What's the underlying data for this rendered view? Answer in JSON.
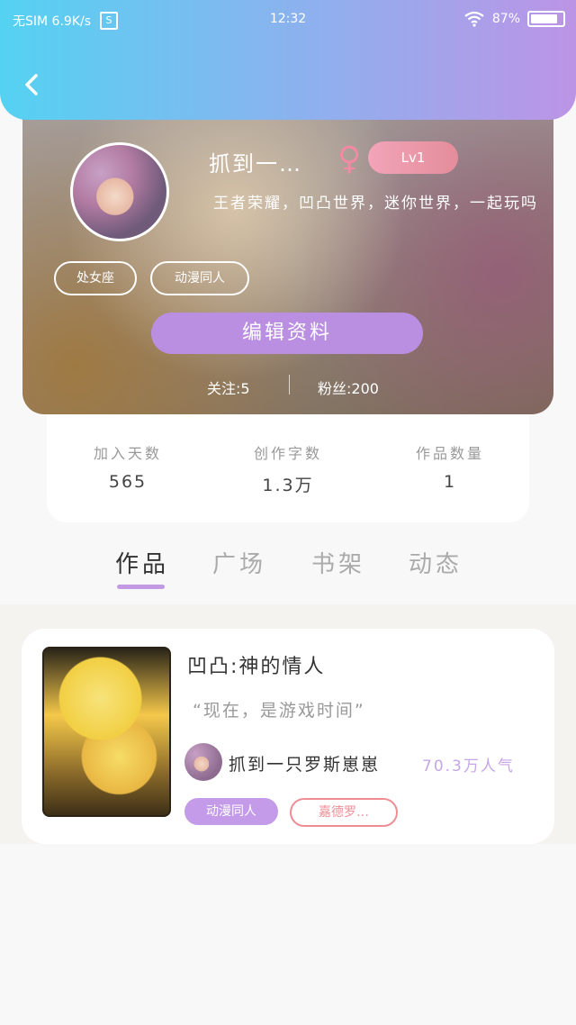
{
  "status_bar": {
    "carrier": "无SIM 6.9K/s",
    "s_badge": "S",
    "time": "12:32",
    "battery_text": "87%",
    "battery_level": 0.87
  },
  "profile": {
    "name": "抓到一…",
    "gender_symbol": "♀",
    "level": "Lv1",
    "bio": "王者荣耀，凹凸世界，迷你世界，一起玩吗",
    "tags": [
      "处女座",
      "动漫同人"
    ],
    "edit_button": "编辑资料",
    "following": "关注:5",
    "followers": "粉丝:200"
  },
  "stats": [
    {
      "label": "加入天数",
      "value": "565"
    },
    {
      "label": "创作字数",
      "value": "1.3万"
    },
    {
      "label": "作品数量",
      "value": "1"
    }
  ],
  "tabs": [
    {
      "label": "作品",
      "active": true
    },
    {
      "label": "广场",
      "active": false
    },
    {
      "label": "书架",
      "active": false
    },
    {
      "label": "动态",
      "active": false
    }
  ],
  "work": {
    "title": "凹凸:神的情人",
    "quote": "“现在，是游戏时间”",
    "author": "抓到一只罗斯崽崽",
    "popularity": "70.3万人气",
    "tags": [
      "动漫同人",
      "嘉德罗…"
    ]
  },
  "colors": {
    "header_gradient_start": "#54d2f2",
    "header_gradient_end": "#bc94e6",
    "accent_purple": "#ba8ee1",
    "level_pink": "#e48d9b",
    "popularity_purple": "#c6a6e6",
    "tag_red": "#ef8d95"
  },
  "icons": {
    "back": "back-chevron-icon",
    "wifi": "wifi-icon",
    "battery": "battery-icon",
    "gender": "female-icon"
  }
}
